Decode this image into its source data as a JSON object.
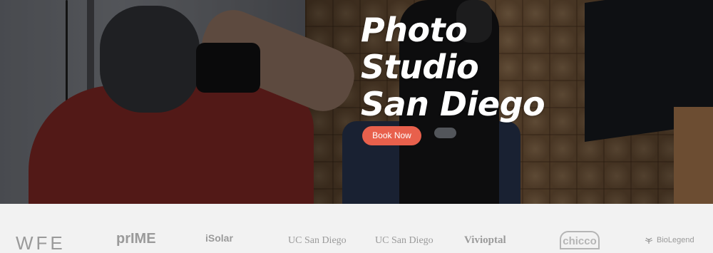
{
  "hero": {
    "title_line1": "Photo",
    "title_line2": "Studio",
    "title_line3": "San Diego",
    "cta_label": "Book Now",
    "cta_color": "#e8604c",
    "title_color": "#ffffff"
  },
  "partners": {
    "logos": [
      {
        "label": "WFE",
        "icon": "wfe-logo"
      },
      {
        "label": "prIME",
        "icon": "prime-logo"
      },
      {
        "label": "iSolar",
        "icon": "solar-logo"
      },
      {
        "label": "UC San Diego",
        "icon": "ucsd-logo"
      },
      {
        "label": "UC San Diego",
        "icon": "ucsd-logo"
      },
      {
        "label": "Vivioptal",
        "icon": "vivioptal-logo"
      },
      {
        "label": "chicco",
        "icon": "chicco-logo"
      },
      {
        "label": "BioLegend",
        "icon": "biolegend-logo"
      }
    ]
  }
}
